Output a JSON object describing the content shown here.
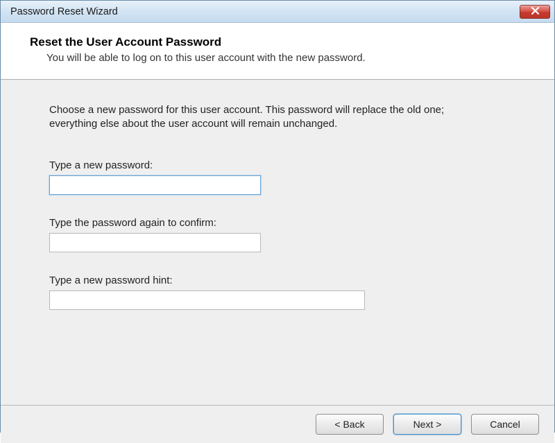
{
  "titlebar": {
    "title": "Password Reset Wizard"
  },
  "header": {
    "title": "Reset the User Account Password",
    "subtitle": "You will be able to log on to this user account with the new password."
  },
  "content": {
    "instruction": "Choose a new password for this user account. This password will replace the old one; everything else about the user account will remain unchanged.",
    "fields": {
      "password": {
        "label": "Type a new password:",
        "value": ""
      },
      "confirm": {
        "label": "Type the password again to confirm:",
        "value": ""
      },
      "hint": {
        "label": "Type a new password hint:",
        "value": ""
      }
    }
  },
  "buttons": {
    "back": "< Back",
    "next": "Next >",
    "cancel": "Cancel"
  }
}
